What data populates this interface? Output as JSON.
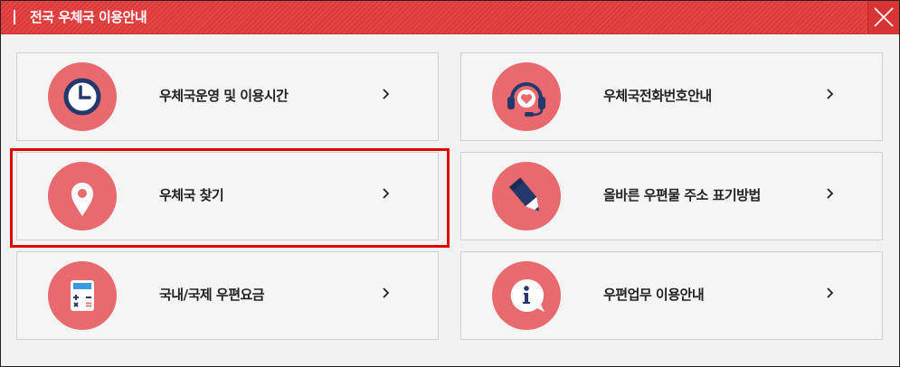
{
  "header": {
    "title": "전국 우체국 이용안내"
  },
  "menu": {
    "hours": {
      "label": "우체국운영 및 이용시간"
    },
    "phone": {
      "label": "우체국전화번호안내"
    },
    "find": {
      "label": "우체국 찾기"
    },
    "address": {
      "label": "올바른 우편물 주소 표기방법"
    },
    "rates": {
      "label": "국내/국제 우편요금"
    },
    "guide": {
      "label": "우편업무 이용안내"
    }
  },
  "icons": {
    "hours": "clock-icon",
    "phone": "headset-heart-icon",
    "find": "location-pin-icon",
    "address": "pencil-icon",
    "rates": "calculator-icon",
    "guide": "info-bubble-icon"
  },
  "colors": {
    "header": "#e33b3b",
    "icon_circle": "#e86a6e",
    "icon_navy": "#23396b",
    "highlight_border": "#e00000"
  }
}
